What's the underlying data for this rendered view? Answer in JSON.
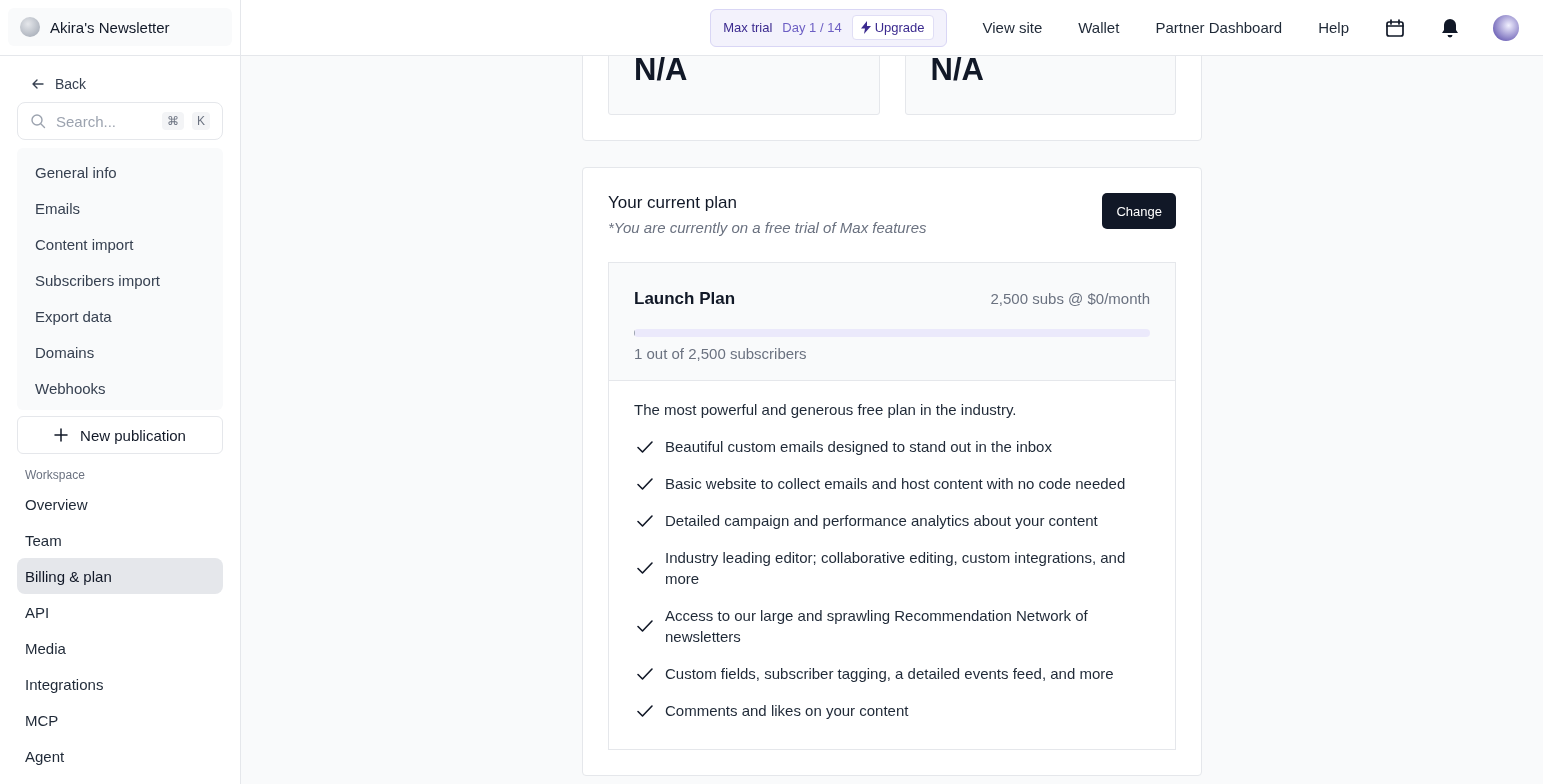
{
  "sidebar": {
    "publication": "Akira's Newsletter",
    "back": "Back",
    "search": {
      "placeholder": "Search...",
      "shortcut": [
        "⌘",
        "K"
      ]
    },
    "settings_items": [
      {
        "label": "General info",
        "selected": false
      },
      {
        "label": "Emails",
        "selected": false
      },
      {
        "label": "Content import",
        "selected": false
      },
      {
        "label": "Subscribers import",
        "selected": false
      },
      {
        "label": "Export data",
        "selected": false
      },
      {
        "label": "Domains",
        "selected": false
      },
      {
        "label": "Webhooks",
        "selected": false
      }
    ],
    "new_publication": "New publication",
    "workspace_heading": "Workspace",
    "workspace_items": [
      {
        "label": "Overview",
        "selected": false
      },
      {
        "label": "Team",
        "selected": false
      },
      {
        "label": "Billing & plan",
        "selected": true
      },
      {
        "label": "API",
        "selected": false
      },
      {
        "label": "Media",
        "selected": false
      },
      {
        "label": "Integrations",
        "selected": false
      },
      {
        "label": "MCP",
        "selected": false
      },
      {
        "label": "Agent",
        "selected": false
      }
    ]
  },
  "topbar": {
    "trial": {
      "label": "Max trial",
      "day": "Day 1 / 14",
      "upgrade": "Upgrade"
    },
    "links": [
      "View site",
      "Wallet",
      "Partner Dashboard",
      "Help"
    ]
  },
  "stats": [
    {
      "value": "N/A"
    },
    {
      "value": "N/A"
    }
  ],
  "plan": {
    "title": "Your current plan",
    "note": "*You are currently on a free trial of Max features",
    "change": "Change",
    "name": "Launch Plan",
    "price": "2,500 subs @ $0/month",
    "level": 0.0004,
    "usage": "1 out of 2,500 subscribers",
    "description": "The most powerful and generous free plan in the industry.",
    "features": [
      "Beautiful custom emails designed to stand out in the inbox",
      "Basic website to collect emails and host content with no code needed",
      "Detailed campaign and performance analytics about your content",
      "Industry leading editor; collaborative editing, custom integrations, and more",
      "Access to our large and sprawling Recommendation Network of newsletters",
      "Custom fields, subscriber tagging, a detailed events feed, and more",
      "Comments and likes on your content"
    ]
  }
}
